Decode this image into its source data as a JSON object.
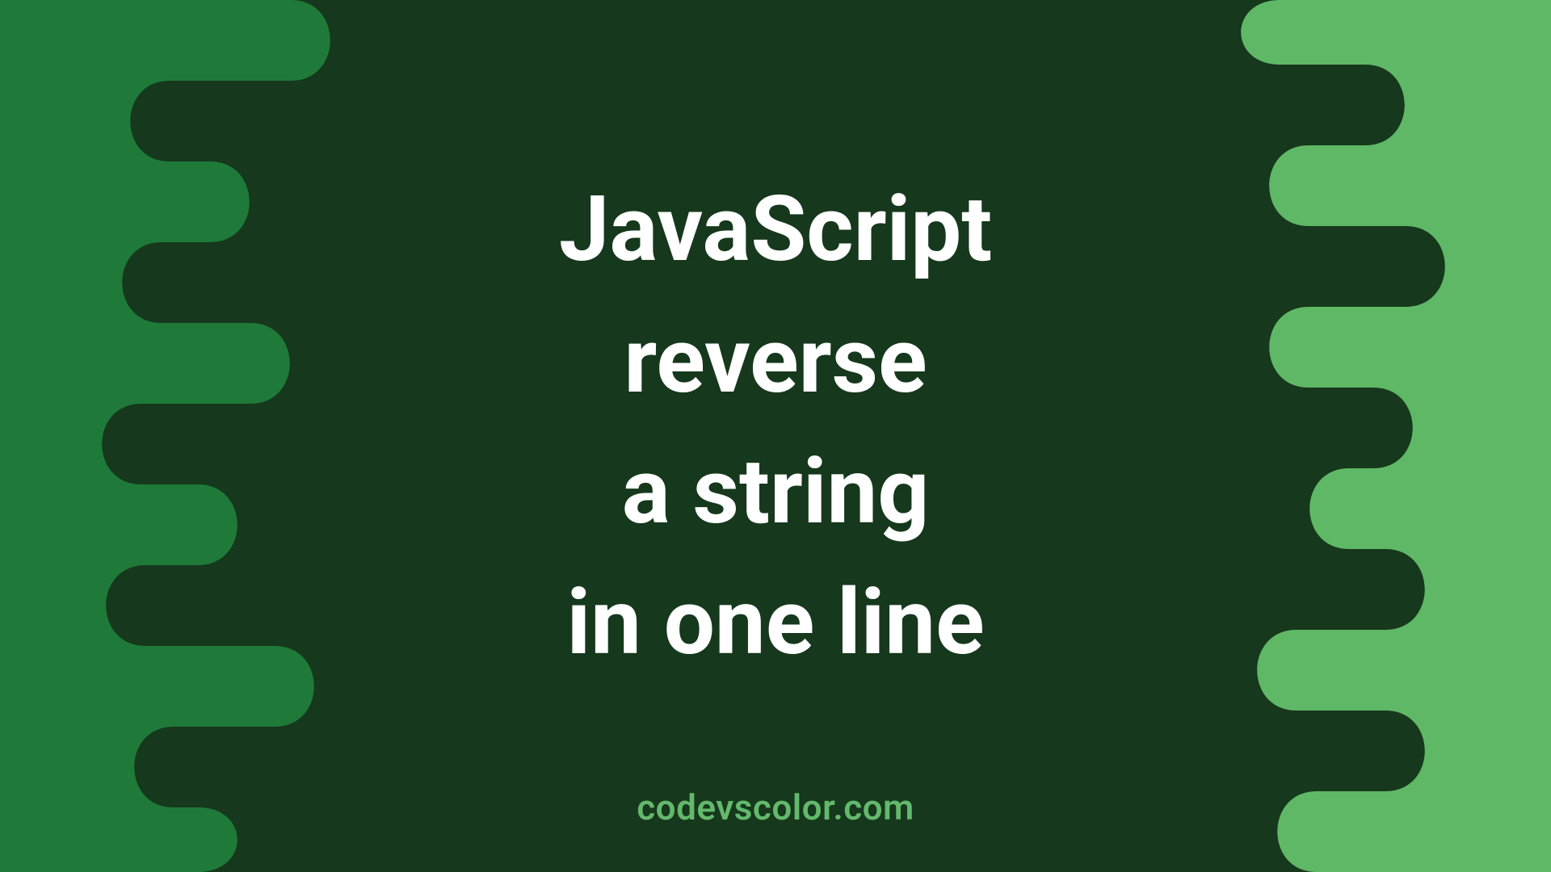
{
  "title": {
    "line1": "JavaScript",
    "line2": "reverse",
    "line3": "a string",
    "line4": "in one line"
  },
  "credit": "codevscolor.com",
  "colors": {
    "bg_dark": "#16381c",
    "blob_left": "#1f7a3a",
    "blob_right": "#5fb866",
    "text": "#ffffff",
    "credit": "#63b86c"
  }
}
